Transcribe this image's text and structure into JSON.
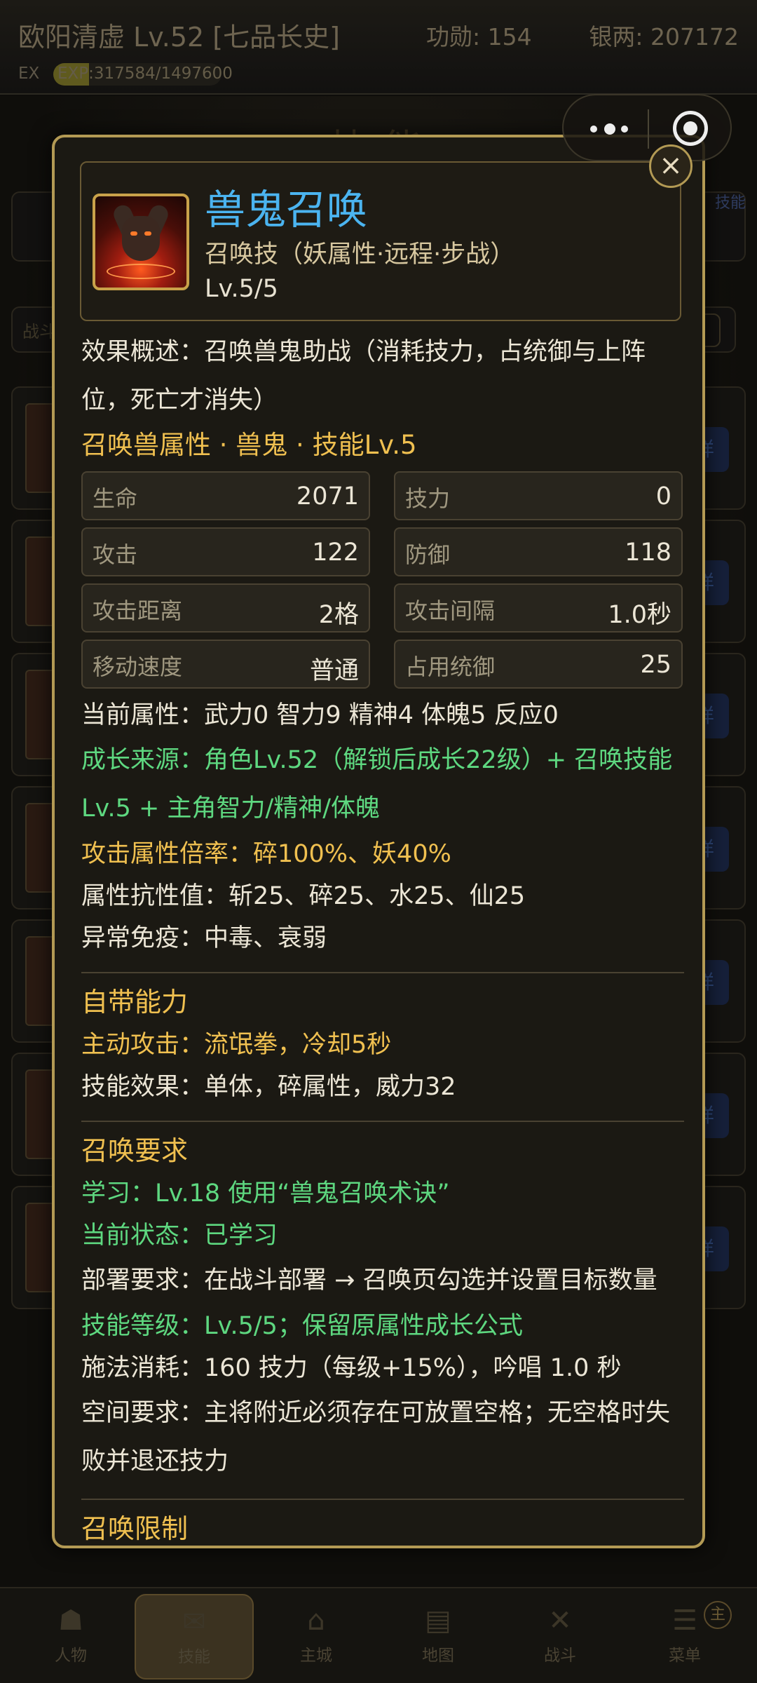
{
  "header": {
    "player_name": "欧阳清虚 Lv.52 [七品长史]",
    "merit": "功勋: 154",
    "silver": "银两: 207172",
    "ex_label": "EX",
    "exp_text": "EXP:317584/1497600",
    "exp_progress": 0.212
  },
  "background_page": {
    "title": "技能",
    "search_label": "战斗",
    "skill_button": "技能",
    "detail_button": "详"
  },
  "capsule": {
    "more_icon": "more-dots-icon",
    "close_icon": "target-circle-icon"
  },
  "modal": {
    "close_symbol": "×",
    "skill_name": "兽鬼召唤",
    "skill_type": "召唤技（妖属性·远程·步战）",
    "skill_level": "Lv.5/5",
    "summary": "效果概述：召唤兽鬼助战（消耗技力，占统御与上阵位，死亡才消失）",
    "summon_header": "召唤兽属性 · 兽鬼 · 技能Lv.5",
    "stats": [
      {
        "label": "生命",
        "value": "2071"
      },
      {
        "label": "技力",
        "value": "0"
      },
      {
        "label": "攻击",
        "value": "122"
      },
      {
        "label": "防御",
        "value": "118"
      },
      {
        "label": "攻击距离",
        "value": "2格"
      },
      {
        "label": "攻击间隔",
        "value": "1.0秒"
      },
      {
        "label": "移动速度",
        "value": "普通"
      },
      {
        "label": "占用统御",
        "value": "25"
      }
    ],
    "current_attrs": "当前属性：武力0  智力9  精神4  体魄5  反应0",
    "growth_source": "成长来源：角色Lv.52（解锁后成长22级）+ 召唤技能Lv.5 + 主角智力/精神/体魄",
    "attack_multiplier": "攻击属性倍率：碎100%、妖40%",
    "resistances": "属性抗性值：斩25、碎25、水25、仙25",
    "immunities": "异常免疫：中毒、衰弱",
    "innate_title": "自带能力",
    "active_attack": "主动攻击：流氓拳，冷却5秒",
    "skill_effect": "技能效果：单体，碎属性，威力32",
    "requirements_title": "召唤要求",
    "learn": "学习：Lv.18 使用“兽鬼召唤术诀”",
    "status": "当前状态：已学习",
    "deploy": "部署要求：在战斗部署 → 召唤页勾选并设置目标数量",
    "skill_level_note": "技能等级：Lv.5/5；保留原属性成长公式",
    "cast_cost": "施法消耗：160 技力（每级+15%），吟唱 1.0 秒",
    "space_req": "空间要求：主将附近必须存在可放置空格；无空格时失败并退还技力",
    "limits_title": "召唤限制"
  },
  "bottom_nav": {
    "items": [
      {
        "label": "人物",
        "icon": "person-icon"
      },
      {
        "label": "技能",
        "icon": "scroll-icon"
      },
      {
        "label": "主城",
        "icon": "castle-icon"
      },
      {
        "label": "地图",
        "icon": "map-icon"
      },
      {
        "label": "战斗",
        "icon": "crossed-swords-icon"
      },
      {
        "label": "菜单",
        "icon": "menu-icon"
      }
    ],
    "active_index": 1,
    "badge": "主"
  }
}
